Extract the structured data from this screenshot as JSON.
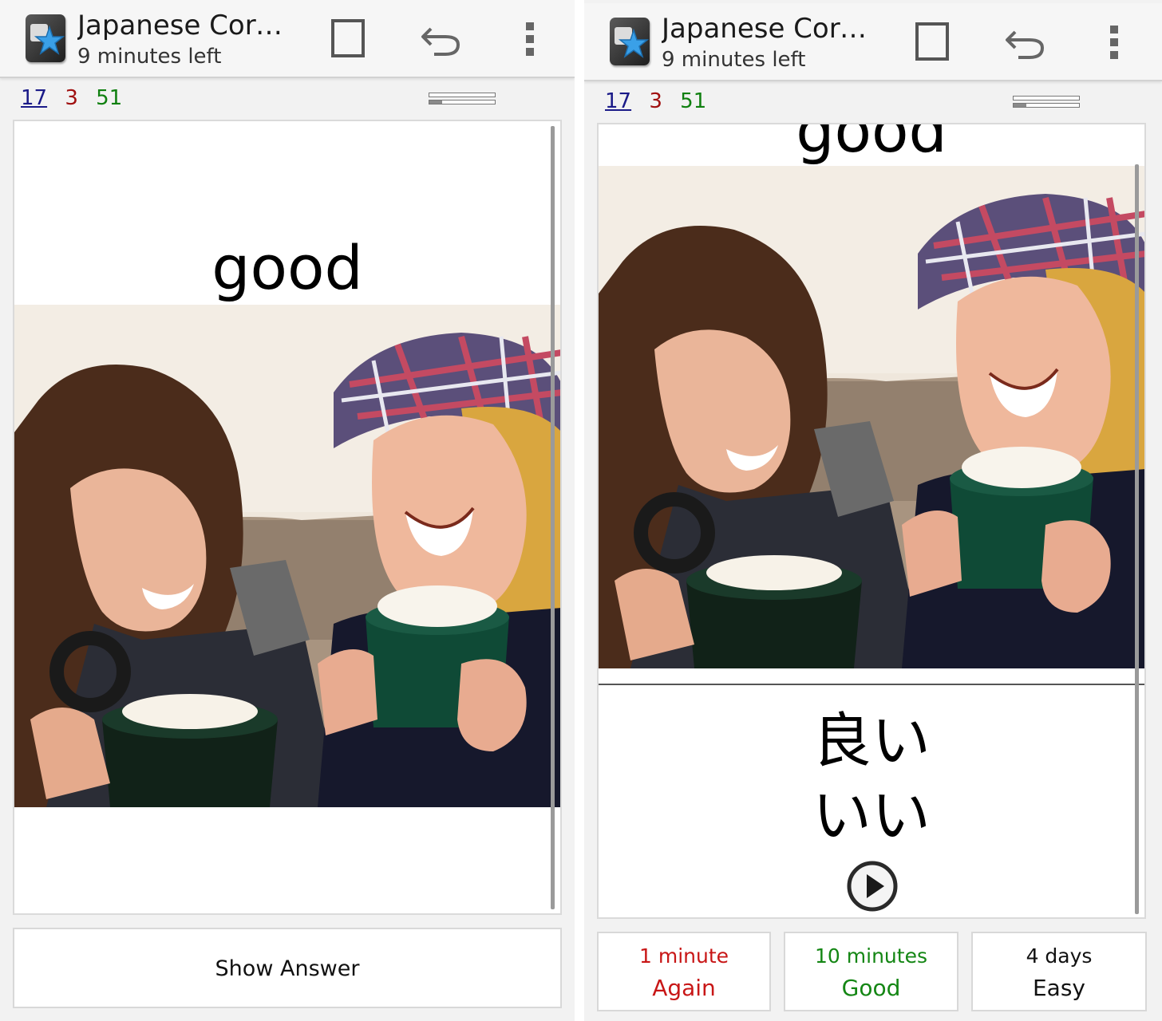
{
  "screens": [
    {
      "title": "Japanese Core...",
      "subtitle": "9 minutes left",
      "counts": {
        "new": "17",
        "learn": "3",
        "review": "51"
      },
      "progress": {
        "top_fraction": 0.0,
        "bottom_fraction": 0.2
      },
      "card": {
        "front": "good"
      },
      "show_answer_label": "Show Answer"
    },
    {
      "title": "Japanese Core...",
      "subtitle": "9 minutes left",
      "counts": {
        "new": "17",
        "learn": "3",
        "review": "51"
      },
      "progress": {
        "top_fraction": 0.0,
        "bottom_fraction": 0.2
      },
      "card": {
        "front": "good",
        "kanji": "良い",
        "kana": "いい"
      },
      "ease_buttons": [
        {
          "time": "1 minute",
          "label": "Again"
        },
        {
          "time": "10 minutes",
          "label": "Good"
        },
        {
          "time": "4 days",
          "label": "Easy"
        }
      ]
    }
  ],
  "icons": {
    "app": "anki-star-icon",
    "mark": "mark-note-icon",
    "undo": "undo-icon",
    "menu": "overflow-menu-icon",
    "audio": "play-audio-icon"
  },
  "colors": {
    "new_count": "#1a1a88",
    "learn_count": "#a01010",
    "review_count": "#108010",
    "again": "#c81616",
    "good": "#148614",
    "easy": "#111111"
  }
}
